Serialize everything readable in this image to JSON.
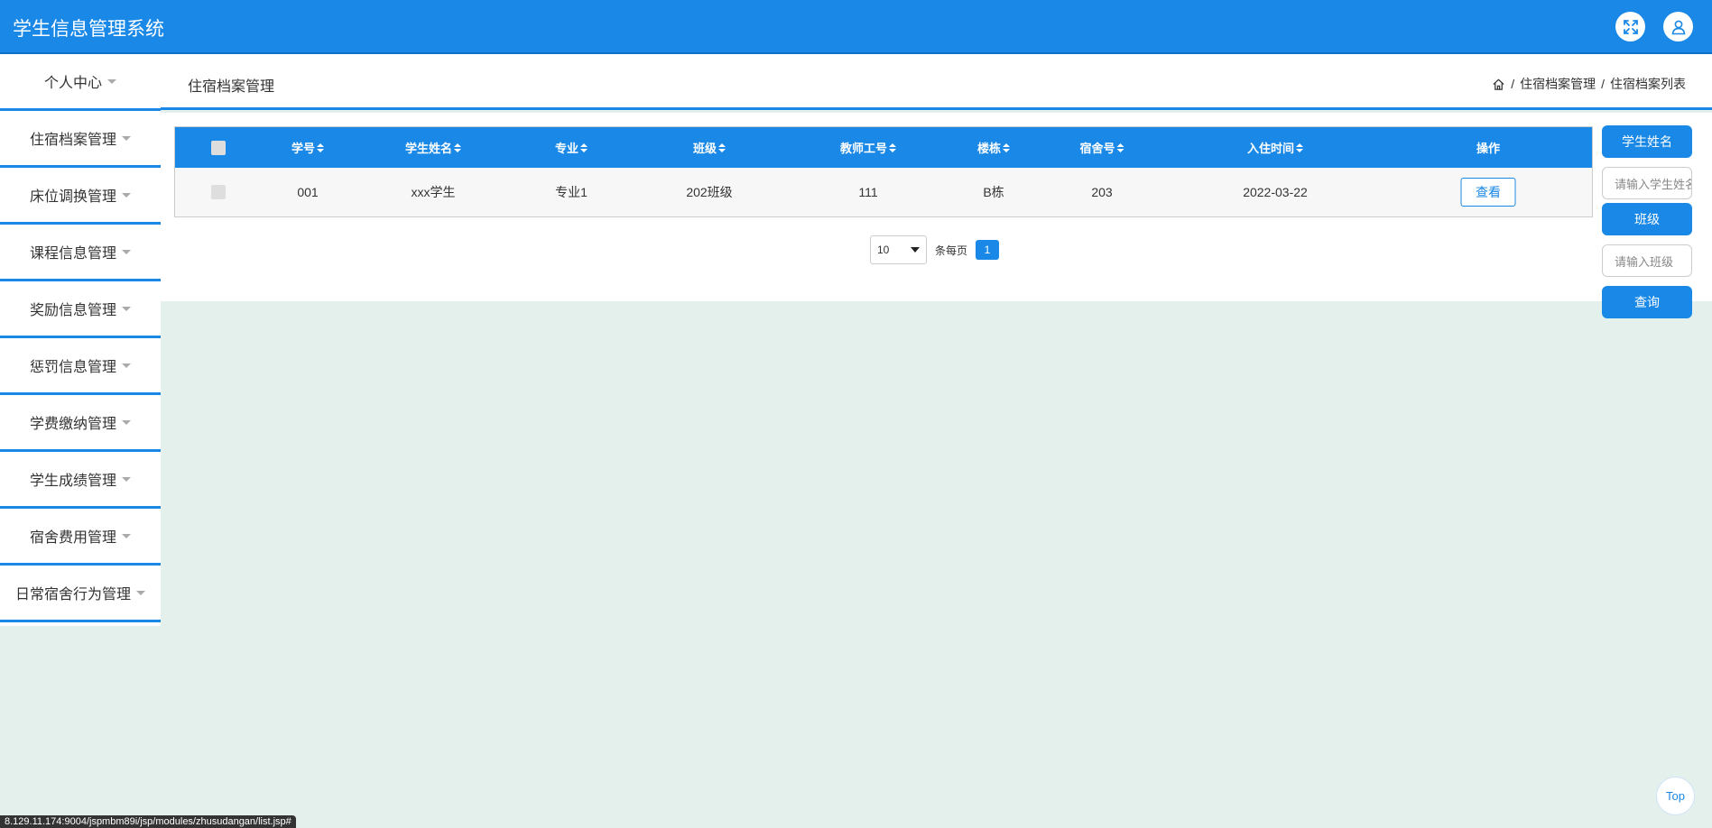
{
  "app": {
    "title": "学生信息管理系统"
  },
  "topbar": {
    "fullscreen_icon": "fullscreen-icon",
    "user_icon": "user-icon"
  },
  "sidebar": {
    "items": [
      {
        "label": "个人中心"
      },
      {
        "label": "住宿档案管理"
      },
      {
        "label": "床位调换管理"
      },
      {
        "label": "课程信息管理"
      },
      {
        "label": "奖励信息管理"
      },
      {
        "label": "惩罚信息管理"
      },
      {
        "label": "学费缴纳管理"
      },
      {
        "label": "学生成绩管理"
      },
      {
        "label": "宿舍费用管理"
      },
      {
        "label": "日常宿舍行为管理"
      }
    ]
  },
  "header": {
    "title": "住宿档案管理",
    "breadcrumb": {
      "sep": "/",
      "level1": "住宿档案管理",
      "level2": "住宿档案列表"
    }
  },
  "table": {
    "columns": [
      "学号",
      "学生姓名",
      "专业",
      "班级",
      "教师工号",
      "楼栋",
      "宿舍号",
      "入住时间",
      "操作"
    ],
    "rows": [
      {
        "xuehao": "001",
        "name": "xxx学生",
        "major": "专业1",
        "class": "202班级",
        "teacher_id": "111",
        "building": "B栋",
        "room": "203",
        "checkin": "2022-03-22",
        "action": "查看"
      }
    ]
  },
  "pagination": {
    "page_size": "10",
    "per_page_label": "条每页",
    "current_page": "1"
  },
  "search": {
    "name_label": "学生姓名",
    "name_placeholder": "请输入学生姓名",
    "class_label": "班级",
    "class_placeholder": "请输入班级",
    "query_label": "查询"
  },
  "back_to_top": "Top",
  "status_url": "8.129.11.174:9004/jspmbm89i/jsp/modules/zhusudangan/list.jsp#",
  "colors": {
    "primary": "#1a88e6",
    "background": "#e4f0ec"
  }
}
